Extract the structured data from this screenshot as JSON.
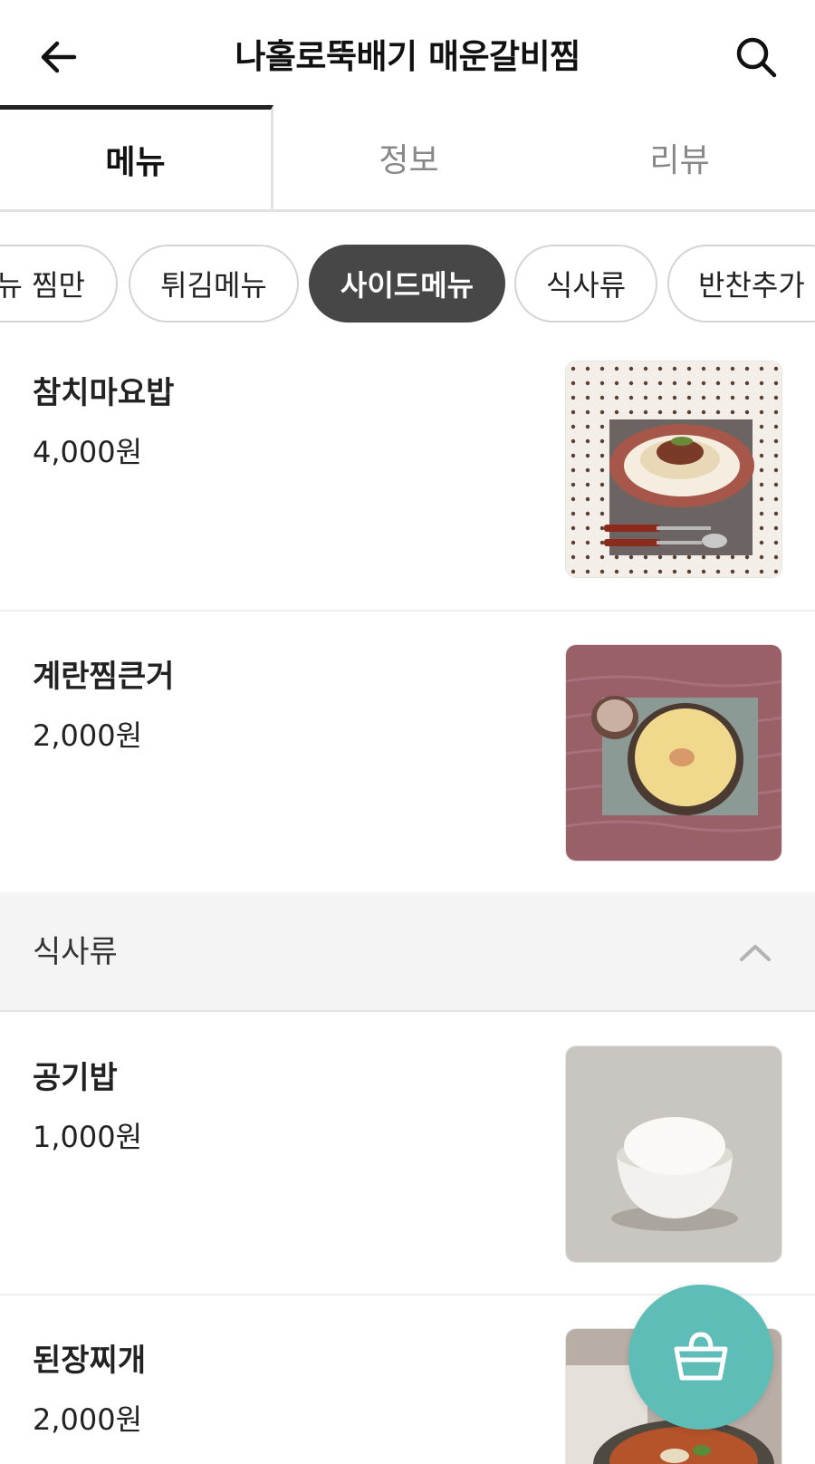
{
  "header": {
    "title": "나홀로뚝배기 매운갈비찜",
    "back_icon": "arrow-left-icon",
    "search_icon": "search-icon"
  },
  "tabs": [
    {
      "label": "메뉴",
      "active": true
    },
    {
      "label": "정보",
      "active": false
    },
    {
      "label": "리뷰",
      "active": false
    }
  ],
  "chips": [
    {
      "label": "뉴 찜만",
      "active": false
    },
    {
      "label": "튀김메뉴",
      "active": false
    },
    {
      "label": "사이드메뉴",
      "active": true
    },
    {
      "label": "식사류",
      "active": false
    },
    {
      "label": "반찬추가",
      "active": false
    }
  ],
  "items": [
    {
      "name": "참치마요밥",
      "price": "4,000원"
    },
    {
      "name": "계란찜큰거",
      "price": "2,000원"
    },
    {
      "name": "공기밥",
      "price": "1,000원"
    },
    {
      "name": "된장찌개",
      "price": "2,000원"
    }
  ],
  "section": {
    "label": "식사류",
    "icon": "chevron-up-icon"
  },
  "cart": {
    "icon": "basket-icon"
  },
  "colors": {
    "accent": "#5fbdb8",
    "chip_active": "#474747"
  }
}
